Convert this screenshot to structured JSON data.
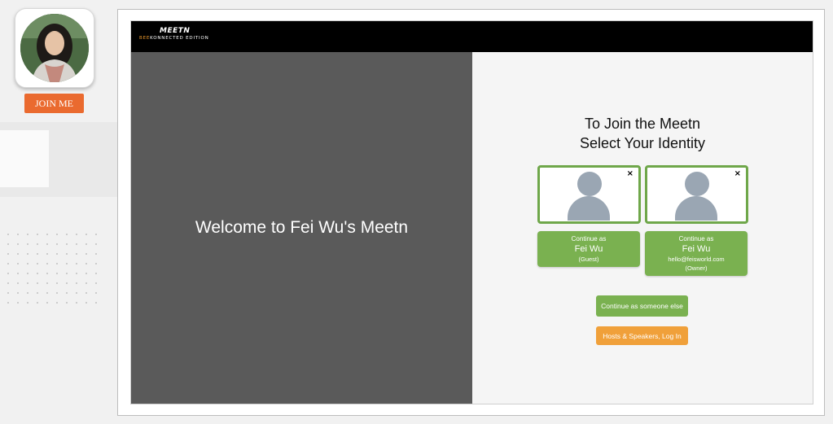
{
  "sidebar": {
    "join_button_label": "JOIN ME"
  },
  "topbar": {
    "logo_title": "MEETN",
    "logo_brand_highlight": "BEE",
    "logo_brand_rest": "KONNECTED",
    "logo_edition": "EDITION"
  },
  "welcome": {
    "text": "Welcome to Fei Wu's Meetn"
  },
  "identity": {
    "heading_line1": "To Join the Meetn",
    "heading_line2": "Select Your Identity",
    "close_symbol": "×",
    "options": [
      {
        "prefix": "Continue as",
        "name": "Fei Wu",
        "email": "",
        "role": "(Guest)"
      },
      {
        "prefix": "Continue as",
        "name": "Fei Wu",
        "email": "hello@feisworld.com",
        "role": "(Owner)"
      }
    ],
    "continue_else_label": "Continue as someone else",
    "host_login_label": "Hosts & Speakers, Log In"
  },
  "colors": {
    "accent_green": "#7ab150",
    "accent_orange": "#f0a03a",
    "join_orange": "#ea6a2f",
    "panel_dark": "#5a5a5a",
    "avatar_placeholder": "#9aa6b3"
  },
  "icons": [
    "close-icon",
    "avatar-placeholder-icon",
    "profile-photo"
  ]
}
